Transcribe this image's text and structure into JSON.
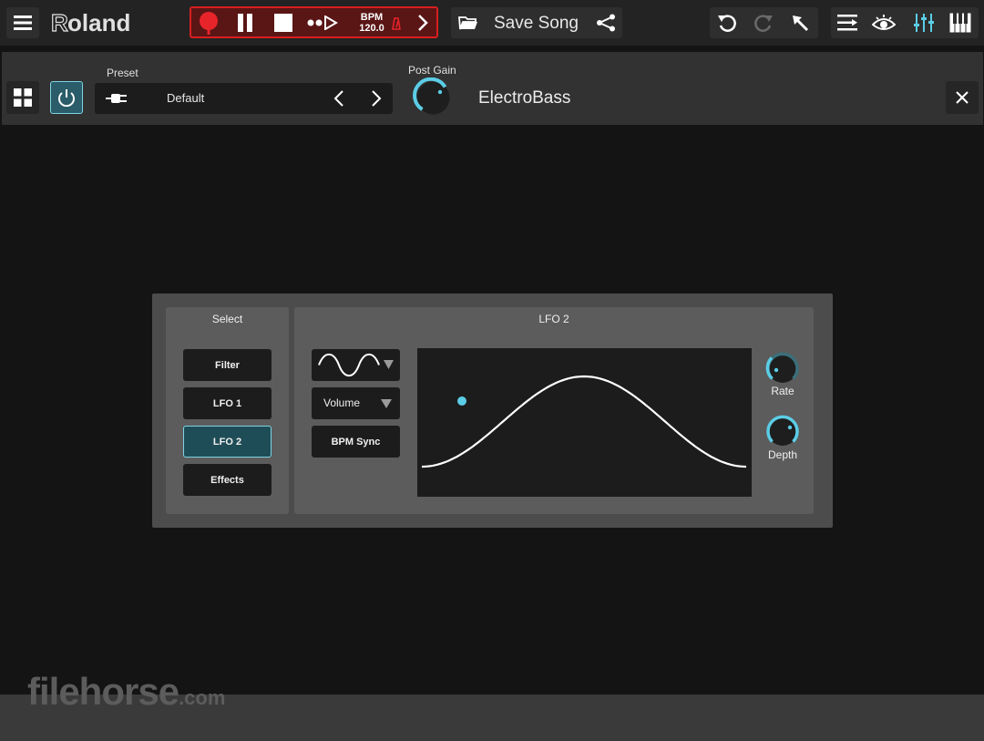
{
  "topbar": {
    "brand": "Roland",
    "transport": {
      "bpm_label": "BPM",
      "bpm_value": "120.0"
    },
    "save_label": "Save Song"
  },
  "plugin": {
    "preset_label": "Preset",
    "preset_name": "Default",
    "post_gain_label": "Post Gain",
    "instrument_name": "ElectroBass"
  },
  "editor": {
    "select_title": "Select",
    "select_items": [
      {
        "label": "Filter",
        "active": false
      },
      {
        "label": "LFO 1",
        "active": false
      },
      {
        "label": "LFO 2",
        "active": true
      },
      {
        "label": "Effects",
        "active": false
      }
    ],
    "lfo_title": "LFO 2",
    "waveform": "sine",
    "destination": "Volume",
    "bpm_sync_label": "BPM Sync",
    "rate_label": "Rate",
    "depth_label": "Depth"
  },
  "watermark": {
    "main": "filehorse",
    "suffix": ".com"
  },
  "colors": {
    "accent": "#5bcde6",
    "record": "#e8242b",
    "transport_bg": "#5a1515",
    "active_tab": "#1f4d57"
  },
  "icons": [
    "menu-icon",
    "record-icon",
    "pause-icon",
    "stop-icon",
    "count-in-icon",
    "metronome-icon",
    "chevron-right-icon",
    "folder-icon",
    "share-icon",
    "undo-icon",
    "redo-icon",
    "pointer-icon",
    "tracks-icon",
    "eye-icon",
    "mixer-icon",
    "keyboard-icon",
    "grid-icon",
    "power-icon",
    "plug-icon",
    "chevron-left-icon",
    "close-icon",
    "sine-wave-icon",
    "dropdown-arrow-icon"
  ]
}
